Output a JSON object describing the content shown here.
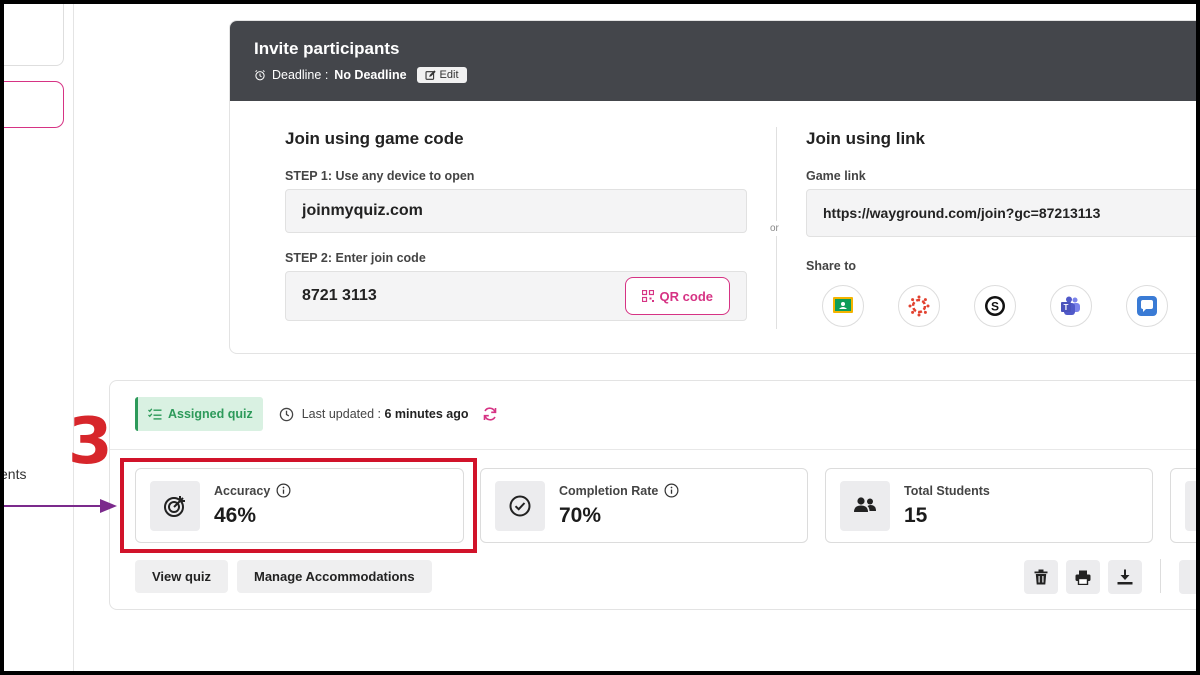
{
  "sidebar": {
    "partial_label": "ents"
  },
  "invite": {
    "title": "Invite participants",
    "deadline_label": "Deadline : ",
    "deadline_value": "No Deadline",
    "edit_label": "Edit",
    "code_section": {
      "title": "Join using game code",
      "step1_label": "STEP 1: Use any device to open",
      "site": "joinmyquiz.com",
      "step2_label": "STEP 2: Enter join code",
      "code": "8721 3113",
      "qr_label": "QR code"
    },
    "or_label": "or",
    "link_section": {
      "title": "Join using link",
      "game_link_label": "Game link",
      "game_link": "https://wayground.com/join?gc=87213113",
      "share_label": "Share to",
      "share_icons": [
        "google-classroom-icon",
        "canvas-icon",
        "schoology-icon",
        "teams-icon",
        "remind-icon"
      ]
    }
  },
  "report": {
    "badge_label": "Assigned quiz",
    "updated_label": "Last updated : ",
    "updated_value": "6 minutes ago",
    "stats": [
      {
        "label": "Accuracy",
        "value": "46%",
        "icon": "target-icon",
        "info": true
      },
      {
        "label": "Completion Rate",
        "value": "70%",
        "icon": "check-circle-icon",
        "info": true
      },
      {
        "label": "Total Students",
        "value": "15",
        "icon": "users-icon",
        "info": false
      }
    ],
    "buttons": {
      "view_quiz": "View quiz",
      "manage_accommodations": "Manage Accommodations"
    },
    "action_icons": [
      "trash-icon",
      "print-icon",
      "download-icon"
    ]
  },
  "annotation": {
    "step_number": "3",
    "color": "#d1132a",
    "arrow_color": "#7b2a8c"
  },
  "colors": {
    "accent_pink": "#d63384",
    "header_dark": "#44464b",
    "assigned_green": "#2d9a5a"
  }
}
